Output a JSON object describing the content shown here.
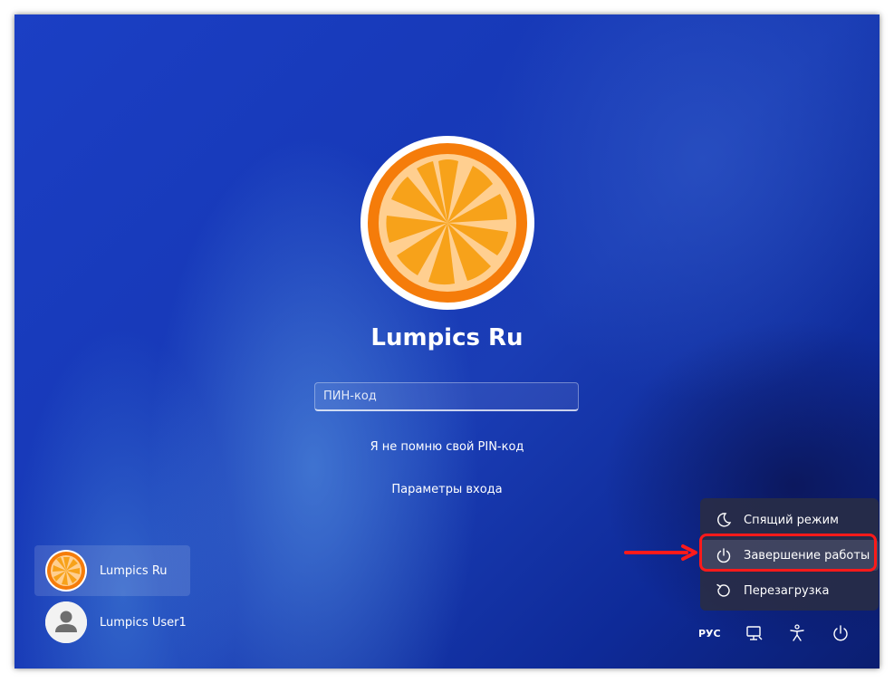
{
  "login": {
    "user_name": "Lumpics Ru",
    "pin_placeholder": "ПИН-код",
    "forgot_pin": "Я не помню свой PIN-код",
    "signin_options": "Параметры входа"
  },
  "users": [
    {
      "name": "Lumpics Ru",
      "avatar": "orange-icon"
    },
    {
      "name": "Lumpics User1",
      "avatar": "person-icon"
    }
  ],
  "power_menu": {
    "items": [
      {
        "label": "Спящий режим",
        "icon": "moon-icon"
      },
      {
        "label": "Завершение работы",
        "icon": "power-icon"
      },
      {
        "label": "Перезагрузка",
        "icon": "restart-icon"
      }
    ]
  },
  "tray": {
    "language": "РУС",
    "icons": [
      "network-icon",
      "accessibility-icon",
      "power-icon"
    ]
  },
  "colors": {
    "highlight": "#ff1a1a",
    "orange": "#f7931e",
    "background": "#1a3db5"
  }
}
